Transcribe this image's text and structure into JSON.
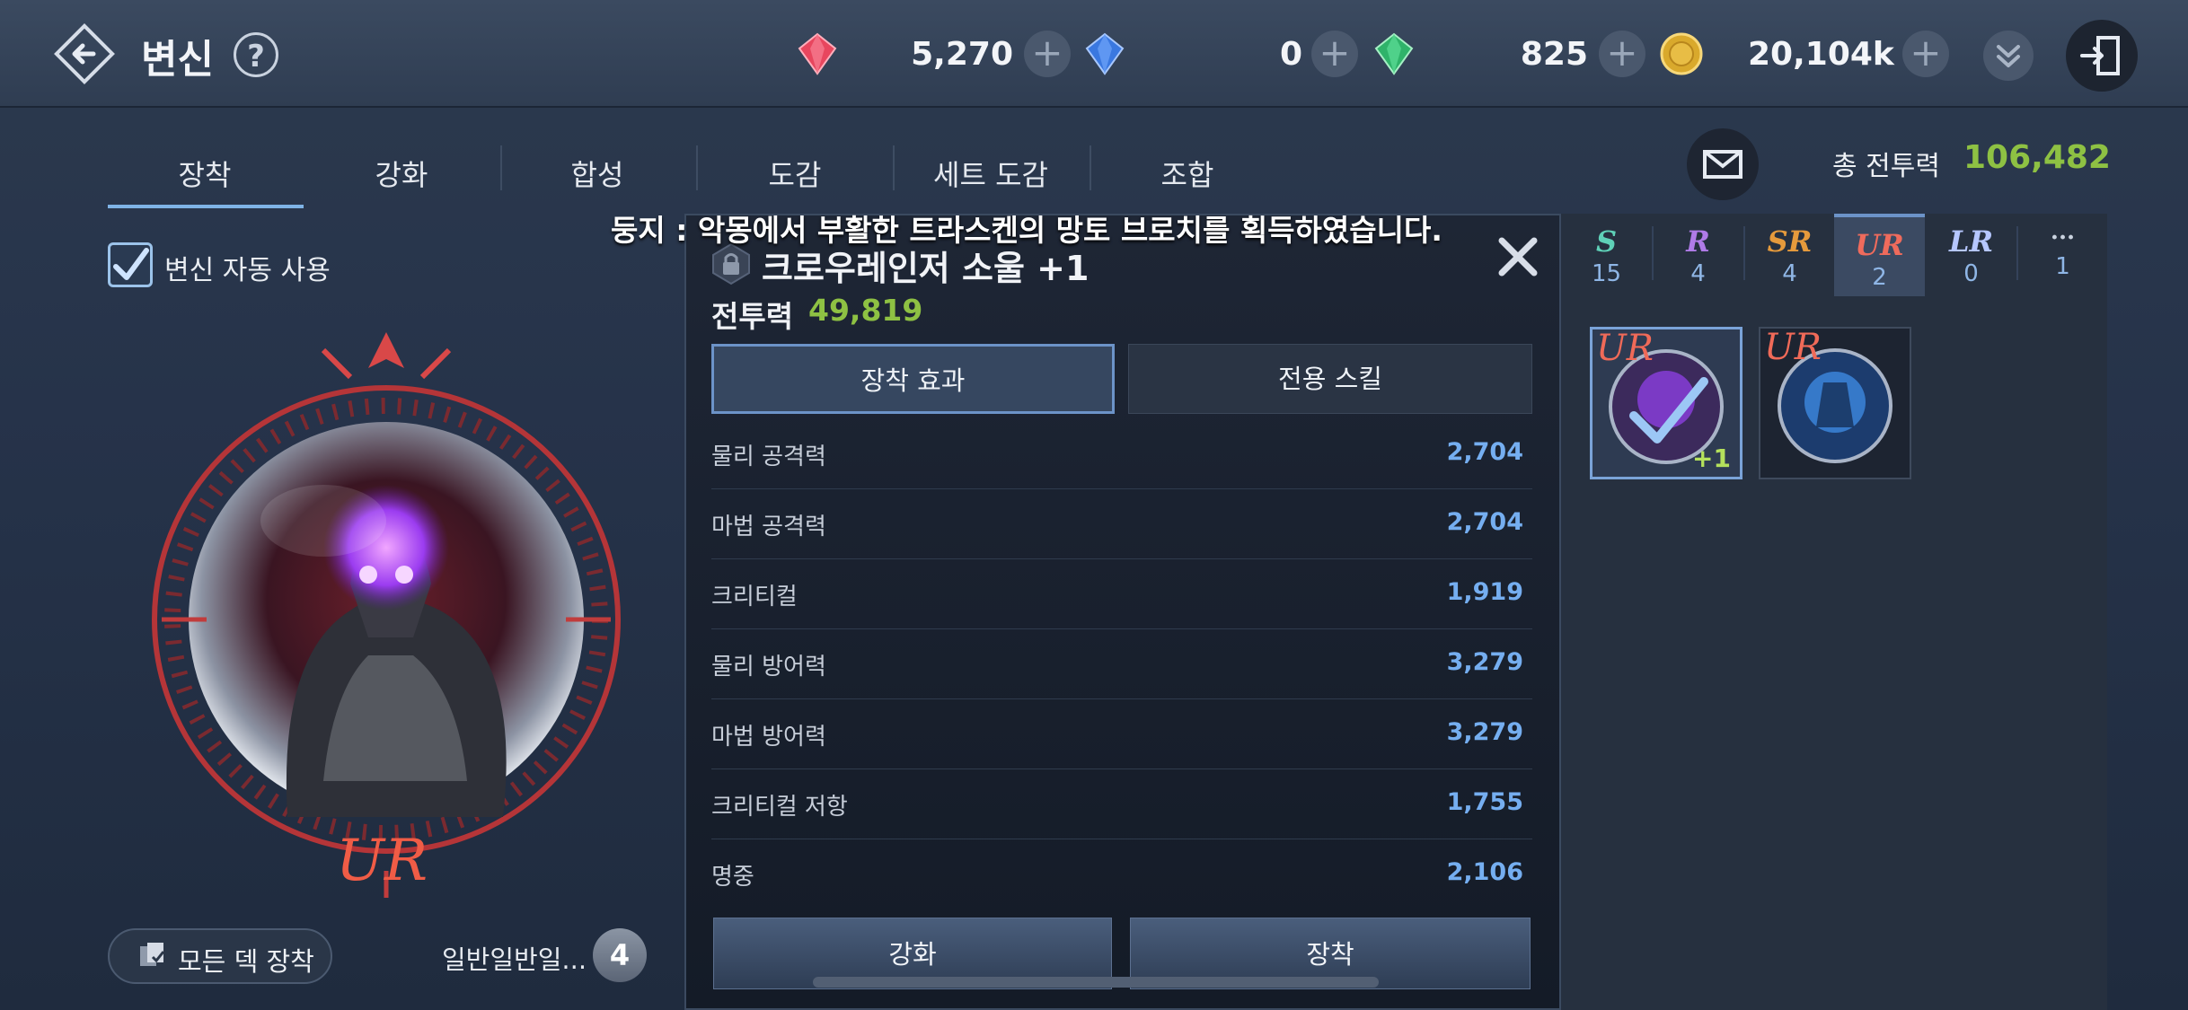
{
  "header": {
    "title": "변신",
    "help": "?",
    "currencies": [
      {
        "name": "red-gem",
        "value": "5,270"
      },
      {
        "name": "blue-gem",
        "value": "0"
      },
      {
        "name": "green-gem",
        "value": "825"
      },
      {
        "name": "gold-coin",
        "value": "20,104k"
      }
    ]
  },
  "tabs": [
    "장착",
    "강화",
    "합성",
    "도감",
    "세트 도감",
    "조합"
  ],
  "notice": "둥지 : 악몽에서 부활한 트라스켄의 망토 브로치를 획득하였습니다.",
  "left": {
    "auto_use_label": "변신 자동 사용",
    "portrait_grade": "UR",
    "deck_button": "모든 덱 장착",
    "preset_name": "일반일반일...",
    "preset_number": "4"
  },
  "detail": {
    "item_name": "크로우레인저 소울  +1",
    "power_label": "전투력",
    "power_value": "49,819",
    "subtabs": [
      "장착 효과",
      "전용 스킬"
    ],
    "stats": [
      {
        "label": "물리 공격력",
        "value": "2,704"
      },
      {
        "label": "마법 공격력",
        "value": "2,704"
      },
      {
        "label": "크리티컬",
        "value": "1,919"
      },
      {
        "label": "물리 방어력",
        "value": "3,279"
      },
      {
        "label": "마법 방어력",
        "value": "3,279"
      },
      {
        "label": "크리티컬 저항",
        "value": "1,755"
      },
      {
        "label": "명중",
        "value": "2,106"
      }
    ],
    "enhance_button": "강화",
    "equip_button": "장착"
  },
  "right": {
    "total_power_label": "총 전투력",
    "total_power_value": "106,482",
    "grade_tabs": [
      {
        "letter": "S",
        "count": "15",
        "color": "#5fd1b8"
      },
      {
        "letter": "R",
        "count": "4",
        "color": "#b07be8"
      },
      {
        "letter": "SR",
        "count": "4",
        "color": "#e59a3c"
      },
      {
        "letter": "UR",
        "count": "2",
        "color": "#ef6b5c"
      },
      {
        "letter": "LR",
        "count": "0",
        "color": "#b6c7ff"
      },
      {
        "letter": "···",
        "count": "1",
        "color": "#c9d2df"
      }
    ],
    "cards": [
      {
        "grade": "UR",
        "enhance": "+1"
      },
      {
        "grade": "UR"
      }
    ]
  }
}
